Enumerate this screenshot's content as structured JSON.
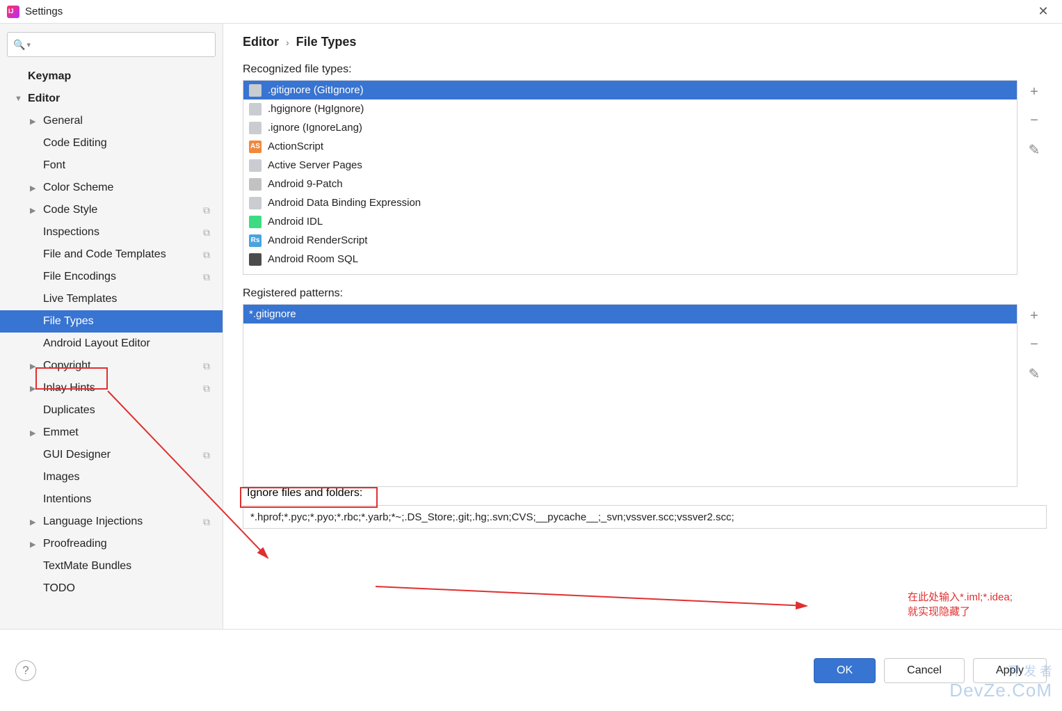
{
  "window": {
    "title": "Settings",
    "close": "✕"
  },
  "sidebar": {
    "search_placeholder": "",
    "items": [
      {
        "label": "Keymap",
        "bold": true,
        "lvl": 0
      },
      {
        "label": "Editor",
        "bold": true,
        "lvl": 0,
        "arrow": "▼"
      },
      {
        "label": "General",
        "lvl": 1,
        "arrow": "▶"
      },
      {
        "label": "Code Editing",
        "lvl": 1
      },
      {
        "label": "Font",
        "lvl": 1
      },
      {
        "label": "Color Scheme",
        "lvl": 1,
        "arrow": "▶"
      },
      {
        "label": "Code Style",
        "lvl": 1,
        "arrow": "▶",
        "copy": true
      },
      {
        "label": "Inspections",
        "lvl": 1,
        "copy": true
      },
      {
        "label": "File and Code Templates",
        "lvl": 1,
        "copy": true
      },
      {
        "label": "File Encodings",
        "lvl": 1,
        "copy": true
      },
      {
        "label": "Live Templates",
        "lvl": 1
      },
      {
        "label": "File Types",
        "lvl": 1,
        "selected": true
      },
      {
        "label": "Android Layout Editor",
        "lvl": 1
      },
      {
        "label": "Copyright",
        "lvl": 1,
        "arrow": "▶",
        "copy": true
      },
      {
        "label": "Inlay Hints",
        "lvl": 1,
        "arrow": "▶",
        "copy": true
      },
      {
        "label": "Duplicates",
        "lvl": 1
      },
      {
        "label": "Emmet",
        "lvl": 1,
        "arrow": "▶"
      },
      {
        "label": "GUI Designer",
        "lvl": 1,
        "copy": true
      },
      {
        "label": "Images",
        "lvl": 1
      },
      {
        "label": "Intentions",
        "lvl": 1
      },
      {
        "label": "Language Injections",
        "lvl": 1,
        "arrow": "▶",
        "copy": true
      },
      {
        "label": "Proofreading",
        "lvl": 1,
        "arrow": "▶"
      },
      {
        "label": "TextMate Bundles",
        "lvl": 1
      },
      {
        "label": "TODO",
        "lvl": 1
      }
    ]
  },
  "breadcrumb": {
    "root": "Editor",
    "sep": "›",
    "leaf": "File Types"
  },
  "filetypes": {
    "label": "Recognized file types:",
    "items": [
      {
        "name": ".gitignore (GitIgnore)",
        "ic": "ic-gray",
        "selected": true
      },
      {
        "name": ".hgignore (HgIgnore)",
        "ic": "ic-gray"
      },
      {
        "name": ".ignore (IgnoreLang)",
        "ic": "ic-gray"
      },
      {
        "name": "ActionScript",
        "ic": "ic-orange",
        "txt": "AS"
      },
      {
        "name": "Active Server Pages",
        "ic": "ic-gray"
      },
      {
        "name": "Android 9-Patch",
        "ic": "ic-folder"
      },
      {
        "name": "Android Data Binding Expression",
        "ic": "ic-gray"
      },
      {
        "name": "Android IDL",
        "ic": "ic-green"
      },
      {
        "name": "Android RenderScript",
        "ic": "ic-blue",
        "txt": "Rs"
      },
      {
        "name": "Android Room SQL",
        "ic": "ic-dark"
      }
    ]
  },
  "patterns": {
    "label": "Registered patterns:",
    "items": [
      {
        "name": "*.gitignore",
        "selected": true
      }
    ]
  },
  "ignore": {
    "label": "Ignore files and folders:",
    "value": "*.hprof;*.pyc;*.pyo;*.rbc;*.yarb;*~;.DS_Store;.git;.hg;.svn;CVS;__pycache__;_svn;vssver.scc;vssver2.scc;"
  },
  "annotation": {
    "line1": "在此处输入*.iml;*.idea;",
    "line2": "就实现隐藏了"
  },
  "watermark": {
    "line1": "开 发 者",
    "line2": "DevZe.CoM"
  },
  "buttons": {
    "help": "?",
    "ok": "OK",
    "cancel": "Cancel",
    "apply": "Apply"
  },
  "tools": {
    "add": "+",
    "remove": "−",
    "edit": "✎"
  }
}
